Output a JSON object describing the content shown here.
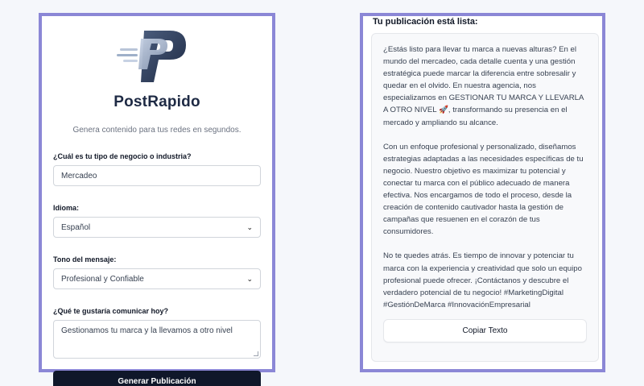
{
  "brand": {
    "name": "PostRapido",
    "tagline": "Genera contenido para tus redes en segundos."
  },
  "form": {
    "business_label": "¿Cuál es tu tipo de negocio o industria?",
    "business_value": "Mercadeo",
    "language_label": "Idioma:",
    "language_value": "Español",
    "tone_label": "Tono del mensaje:",
    "tone_value": "Profesional y Confiable",
    "message_label": "¿Qué te gustaría comunicar hoy?",
    "message_value": "Gestionamos tu marca y la llevamos a otro nivel",
    "generate_label": "Generar Publicación"
  },
  "result": {
    "title": "Tu publicación está lista:",
    "paragraph_1": "¿Estás listo para llevar tu marca a nuevas alturas? En el mundo del mercadeo, cada detalle cuenta y una gestión estratégica puede marcar la diferencia entre sobresalir y quedar en el olvido. En nuestra agencia, nos especializamos en GESTIONAR TU MARCA Y LLEVARLA A OTRO NIVEL 🚀, transformando su presencia en el mercado y ampliando su alcance.",
    "paragraph_2": "Con un enfoque profesional y personalizado, diseñamos estrategias adaptadas a las necesidades específicas de tu negocio. Nuestro objetivo es maximizar tu potencial y conectar tu marca con el público adecuado de manera efectiva. Nos encargamos de todo el proceso, desde la creación de contenido cautivador hasta la gestión de campañas que resuenen en el corazón de tus consumidores.",
    "paragraph_3": "No te quedes atrás. Es tiempo de innovar y potenciar tu marca con la experiencia y creatividad que solo un equipo profesional puede ofrecer. ¡Contáctanos y descubre el verdadero potencial de tu negocio! #MarketingDigital #GestiónDeMarca #InnovaciónEmpresarial",
    "copy_label": "Copiar Texto"
  },
  "colors": {
    "panel_border": "#8b87d6",
    "button_dark": "#0f172a",
    "brand_text": "#1e2a44"
  },
  "icons": {
    "logo": "postrapido-logo-icon",
    "select_arrow": "chevron-down-icon"
  }
}
